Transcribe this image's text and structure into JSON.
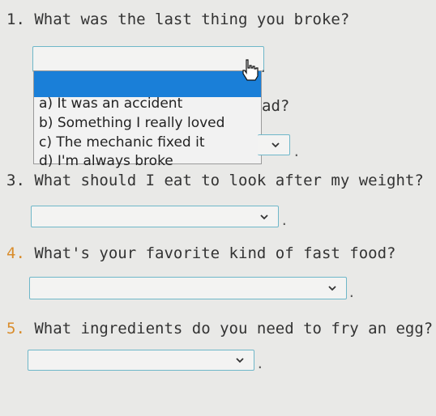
{
  "questions": [
    {
      "number": "1.",
      "text": "What was the last thing you broke?"
    },
    {
      "number": "3.",
      "text": "What should I eat to look after my weight?"
    },
    {
      "number": "4.",
      "text": "What's your favorite kind of fast food?"
    },
    {
      "number": "5.",
      "text": "What ingredients do you need to fry an egg?"
    }
  ],
  "partial_text": "ad?",
  "dropdown_options": [
    "a) It was an accident",
    "b) Something I really loved",
    "c) The mechanic fixed it",
    "d) I'm always broke"
  ],
  "punctuation": ".",
  "colors": {
    "accent": "#6fb7c9",
    "highlight": "#1a7fd8",
    "number_orange": "#d98c2b"
  },
  "icons": {
    "chevron": "chevron-down-icon",
    "cursor": "hand-pointer-icon"
  }
}
